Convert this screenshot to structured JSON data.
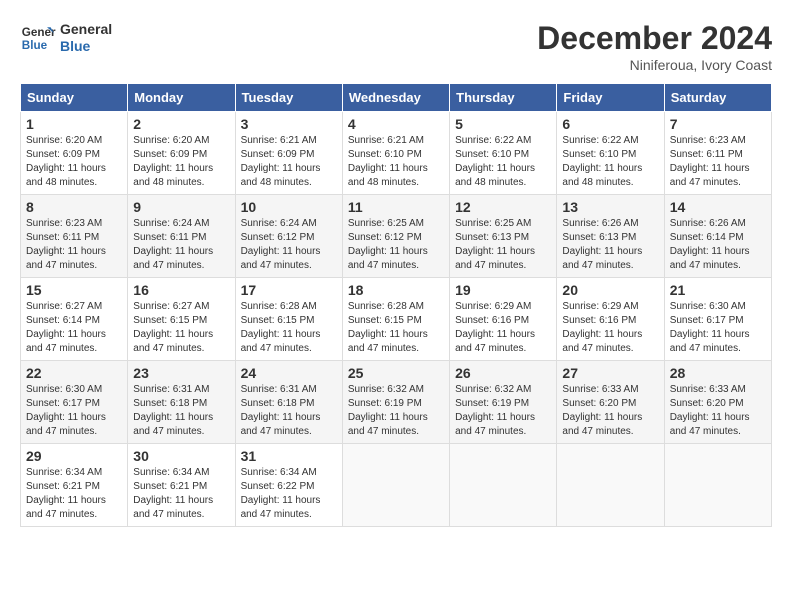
{
  "header": {
    "logo_line1": "General",
    "logo_line2": "Blue",
    "month": "December 2024",
    "location": "Niniferoua, Ivory Coast"
  },
  "weekdays": [
    "Sunday",
    "Monday",
    "Tuesday",
    "Wednesday",
    "Thursday",
    "Friday",
    "Saturday"
  ],
  "weeks": [
    [
      {
        "day": "1",
        "info": "Sunrise: 6:20 AM\nSunset: 6:09 PM\nDaylight: 11 hours\nand 48 minutes."
      },
      {
        "day": "2",
        "info": "Sunrise: 6:20 AM\nSunset: 6:09 PM\nDaylight: 11 hours\nand 48 minutes."
      },
      {
        "day": "3",
        "info": "Sunrise: 6:21 AM\nSunset: 6:09 PM\nDaylight: 11 hours\nand 48 minutes."
      },
      {
        "day": "4",
        "info": "Sunrise: 6:21 AM\nSunset: 6:10 PM\nDaylight: 11 hours\nand 48 minutes."
      },
      {
        "day": "5",
        "info": "Sunrise: 6:22 AM\nSunset: 6:10 PM\nDaylight: 11 hours\nand 48 minutes."
      },
      {
        "day": "6",
        "info": "Sunrise: 6:22 AM\nSunset: 6:10 PM\nDaylight: 11 hours\nand 48 minutes."
      },
      {
        "day": "7",
        "info": "Sunrise: 6:23 AM\nSunset: 6:11 PM\nDaylight: 11 hours\nand 47 minutes."
      }
    ],
    [
      {
        "day": "8",
        "info": "Sunrise: 6:23 AM\nSunset: 6:11 PM\nDaylight: 11 hours\nand 47 minutes."
      },
      {
        "day": "9",
        "info": "Sunrise: 6:24 AM\nSunset: 6:11 PM\nDaylight: 11 hours\nand 47 minutes."
      },
      {
        "day": "10",
        "info": "Sunrise: 6:24 AM\nSunset: 6:12 PM\nDaylight: 11 hours\nand 47 minutes."
      },
      {
        "day": "11",
        "info": "Sunrise: 6:25 AM\nSunset: 6:12 PM\nDaylight: 11 hours\nand 47 minutes."
      },
      {
        "day": "12",
        "info": "Sunrise: 6:25 AM\nSunset: 6:13 PM\nDaylight: 11 hours\nand 47 minutes."
      },
      {
        "day": "13",
        "info": "Sunrise: 6:26 AM\nSunset: 6:13 PM\nDaylight: 11 hours\nand 47 minutes."
      },
      {
        "day": "14",
        "info": "Sunrise: 6:26 AM\nSunset: 6:14 PM\nDaylight: 11 hours\nand 47 minutes."
      }
    ],
    [
      {
        "day": "15",
        "info": "Sunrise: 6:27 AM\nSunset: 6:14 PM\nDaylight: 11 hours\nand 47 minutes."
      },
      {
        "day": "16",
        "info": "Sunrise: 6:27 AM\nSunset: 6:15 PM\nDaylight: 11 hours\nand 47 minutes."
      },
      {
        "day": "17",
        "info": "Sunrise: 6:28 AM\nSunset: 6:15 PM\nDaylight: 11 hours\nand 47 minutes."
      },
      {
        "day": "18",
        "info": "Sunrise: 6:28 AM\nSunset: 6:15 PM\nDaylight: 11 hours\nand 47 minutes."
      },
      {
        "day": "19",
        "info": "Sunrise: 6:29 AM\nSunset: 6:16 PM\nDaylight: 11 hours\nand 47 minutes."
      },
      {
        "day": "20",
        "info": "Sunrise: 6:29 AM\nSunset: 6:16 PM\nDaylight: 11 hours\nand 47 minutes."
      },
      {
        "day": "21",
        "info": "Sunrise: 6:30 AM\nSunset: 6:17 PM\nDaylight: 11 hours\nand 47 minutes."
      }
    ],
    [
      {
        "day": "22",
        "info": "Sunrise: 6:30 AM\nSunset: 6:17 PM\nDaylight: 11 hours\nand 47 minutes."
      },
      {
        "day": "23",
        "info": "Sunrise: 6:31 AM\nSunset: 6:18 PM\nDaylight: 11 hours\nand 47 minutes."
      },
      {
        "day": "24",
        "info": "Sunrise: 6:31 AM\nSunset: 6:18 PM\nDaylight: 11 hours\nand 47 minutes."
      },
      {
        "day": "25",
        "info": "Sunrise: 6:32 AM\nSunset: 6:19 PM\nDaylight: 11 hours\nand 47 minutes."
      },
      {
        "day": "26",
        "info": "Sunrise: 6:32 AM\nSunset: 6:19 PM\nDaylight: 11 hours\nand 47 minutes."
      },
      {
        "day": "27",
        "info": "Sunrise: 6:33 AM\nSunset: 6:20 PM\nDaylight: 11 hours\nand 47 minutes."
      },
      {
        "day": "28",
        "info": "Sunrise: 6:33 AM\nSunset: 6:20 PM\nDaylight: 11 hours\nand 47 minutes."
      }
    ],
    [
      {
        "day": "29",
        "info": "Sunrise: 6:34 AM\nSunset: 6:21 PM\nDaylight: 11 hours\nand 47 minutes."
      },
      {
        "day": "30",
        "info": "Sunrise: 6:34 AM\nSunset: 6:21 PM\nDaylight: 11 hours\nand 47 minutes."
      },
      {
        "day": "31",
        "info": "Sunrise: 6:34 AM\nSunset: 6:22 PM\nDaylight: 11 hours\nand 47 minutes."
      },
      {
        "day": "",
        "info": ""
      },
      {
        "day": "",
        "info": ""
      },
      {
        "day": "",
        "info": ""
      },
      {
        "day": "",
        "info": ""
      }
    ]
  ]
}
